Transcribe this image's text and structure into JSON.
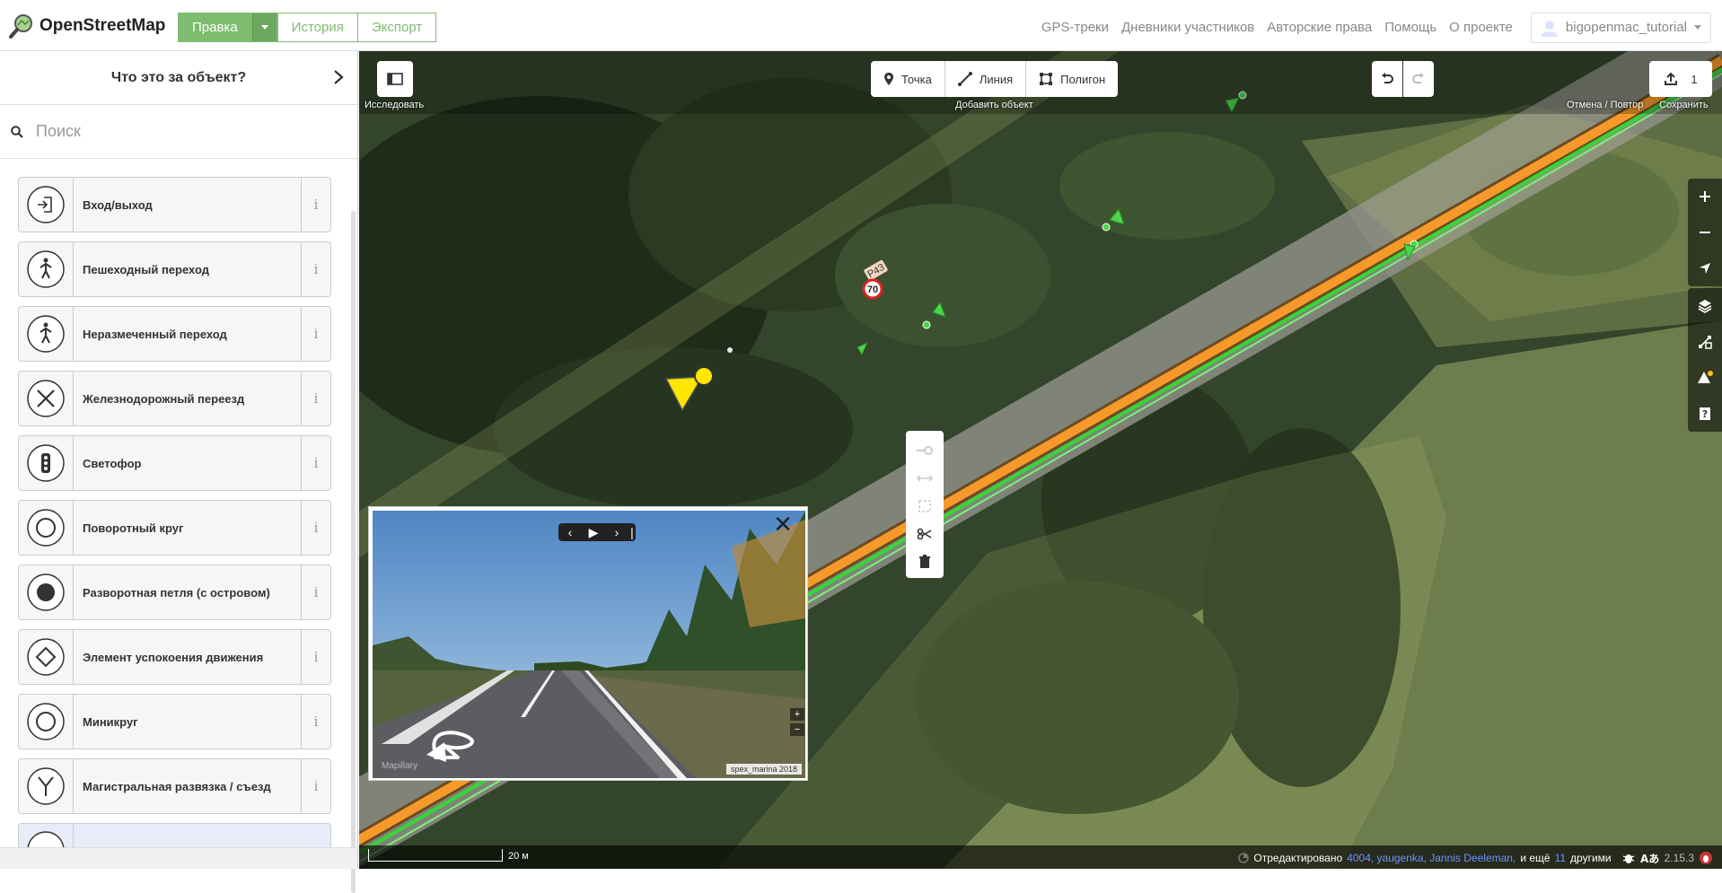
{
  "app": {
    "logo_text": "OpenStreetMap"
  },
  "topbar": {
    "edit_label": "Правка",
    "history_label": "История",
    "export_label": "Экспорт",
    "nav": [
      "GPS-треки",
      "Дневники участников",
      "Авторские права",
      "Помощь",
      "О проекте"
    ],
    "username": "bigopenmac_tutorial"
  },
  "sidebar": {
    "title": "Что это за объект?",
    "search_placeholder": "Поиск",
    "presets": [
      {
        "label": "Вход/выход",
        "icon": "entrance-icon"
      },
      {
        "label": "Пешеходный переход",
        "icon": "pedestrian-icon"
      },
      {
        "label": "Неразмеченный переход",
        "icon": "pedestrian-icon"
      },
      {
        "label": "Железнодорожный переезд",
        "icon": "railway-crossing-icon"
      },
      {
        "label": "Светофор",
        "icon": "traffic-signals-icon"
      },
      {
        "label": "Поворотный круг",
        "icon": "circle-outline-icon"
      },
      {
        "label": "Разворотная петля (с островом)",
        "icon": "circle-filled-icon"
      },
      {
        "label": "Элемент успокоения движения",
        "icon": "diamond-icon"
      },
      {
        "label": "Миникруг",
        "icon": "circle-outline-icon"
      },
      {
        "label": "Магистральная развязка / съезд",
        "icon": "junction-icon"
      }
    ],
    "info_symbol": "i"
  },
  "map": {
    "explore_label": "Исследовать",
    "add_point": "Точка",
    "add_line": "Линия",
    "add_area": "Полигон",
    "add_feature_caption": "Добавить объект",
    "undo_redo_caption": "Отмена / Повтор",
    "save_count": "1",
    "save_caption": "Сохранить",
    "road_ref": "Р43",
    "speed_limit": "70",
    "accent_color": "#7ebc6f"
  },
  "photo_viewer": {
    "credit": "spex_marina 2018",
    "brand": "Mapillary",
    "close_symbol": "✕"
  },
  "footer": {
    "scale_label": "20 м",
    "edited_by_prefix": "Отредактировано",
    "editors": "4004, yaugenka, Jannis Deeleman,",
    "and_more_prefix": "и ещё",
    "more_count": "11",
    "and_more_suffix": "другими",
    "version": "2.15.3"
  }
}
